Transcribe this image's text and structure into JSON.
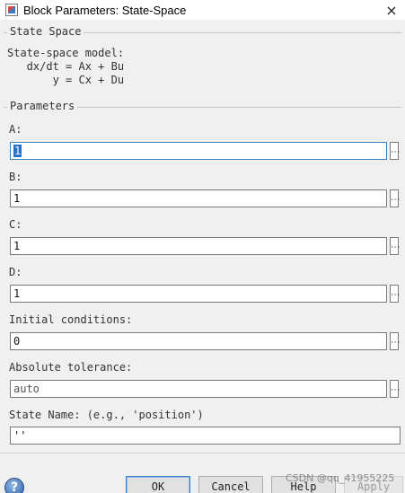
{
  "window": {
    "title": "Block Parameters: State-Space",
    "close_glyph": "×"
  },
  "state_space_group": {
    "legend": "State Space",
    "description": "State-space model:\n   dx/dt = Ax + Bu\n       y = Cx + Du"
  },
  "parameters_group": {
    "legend": "Parameters",
    "fields": [
      {
        "label": "A:",
        "value": "1"
      },
      {
        "label": "B:",
        "value": "1"
      },
      {
        "label": "C:",
        "value": "1"
      },
      {
        "label": "D:",
        "value": "1"
      },
      {
        "label": "Initial conditions:",
        "value": "0"
      },
      {
        "label": "Absolute tolerance:",
        "value": "auto"
      },
      {
        "label": "State Name: (e.g., 'position')",
        "value": "''"
      }
    ],
    "more_glyph": "⋮"
  },
  "buttons": {
    "help_glyph": "?",
    "ok": "OK",
    "cancel": "Cancel",
    "help": "Help",
    "apply": "Apply"
  },
  "watermark": "CSDN @qq_41955225",
  "colors": {
    "background": "#f0f0f0",
    "focus_border": "#3b82c4",
    "selection": "#2a6fc9"
  }
}
